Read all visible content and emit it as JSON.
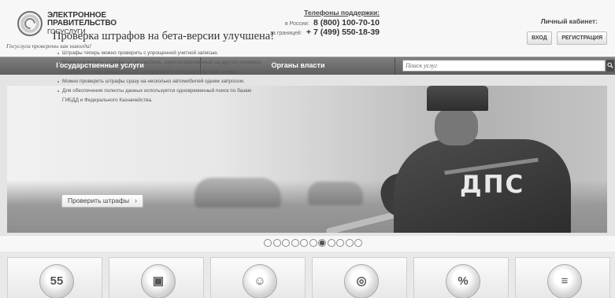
{
  "header": {
    "logo_lines": [
      "ЭЛЕКТРОННОЕ",
      "ПРАВИТЕЛЬСТВО",
      "ГОСУСЛУГИ"
    ],
    "tagline": "Госуслуги проверены как никогда!",
    "support": {
      "title": "Телефоны поддержки:",
      "russia_label": "в России:",
      "russia_phone": "8 (800) 100-70-10",
      "abroad_label": "за границей:",
      "abroad_phone": "+ 7 (499) 550-18-39"
    },
    "cabinet": {
      "title": "Личный кабинет:",
      "login_label": "ВХОД",
      "register_label": "РЕГИСТРАЦИЯ"
    }
  },
  "nav": {
    "items": [
      {
        "label": "Государственные услуги"
      },
      {
        "label": "Органы власти"
      }
    ],
    "search": {
      "placeholder": "Поиск услуг"
    }
  },
  "banner": {
    "title": "Проверка штрафов на бета-версии улучшена!",
    "lines": [
      {
        "text": "Штрафы теперь можно проверить с упрощенной учетной записью.",
        "bullet": true
      },
      {
        "text": "Можно проверить штрафы на автомобиль, зарегистрированный на другого человека",
        "bullet": true
      },
      {
        "text": "(требуется номер свидетельства о регистрации и государственный номер).",
        "bullet": false
      },
      {
        "text": "Можно проверить штрафы сразу на несколько автомобилей одним запросом.",
        "bullet": true
      },
      {
        "text": "Для обеспечения полноты данных используется одновременный поиск по базам",
        "bullet": true
      },
      {
        "text": "ГИБДД и Федерального Казначейства.",
        "bullet": false
      }
    ],
    "cta_label": "Проверить штрафы",
    "cta_chevron": "›",
    "vest_text": "ДПС"
  },
  "pager": {
    "count": 11,
    "active_index": 6
  },
  "tiles": [
    {
      "icon": "calendar-55-icon",
      "glyph": "55"
    },
    {
      "icon": "passport-icon",
      "glyph": "▣"
    },
    {
      "icon": "family-icon",
      "glyph": "☺"
    },
    {
      "icon": "lifebuoy-icon",
      "glyph": "◎"
    },
    {
      "icon": "percent-icon",
      "glyph": "%"
    },
    {
      "icon": "certificate-icon",
      "glyph": "≡"
    }
  ],
  "colors": {
    "nav_bg": "#6e6e6e",
    "page_bg": "#f2f2f2",
    "header_bg": "#f7f7f7"
  }
}
